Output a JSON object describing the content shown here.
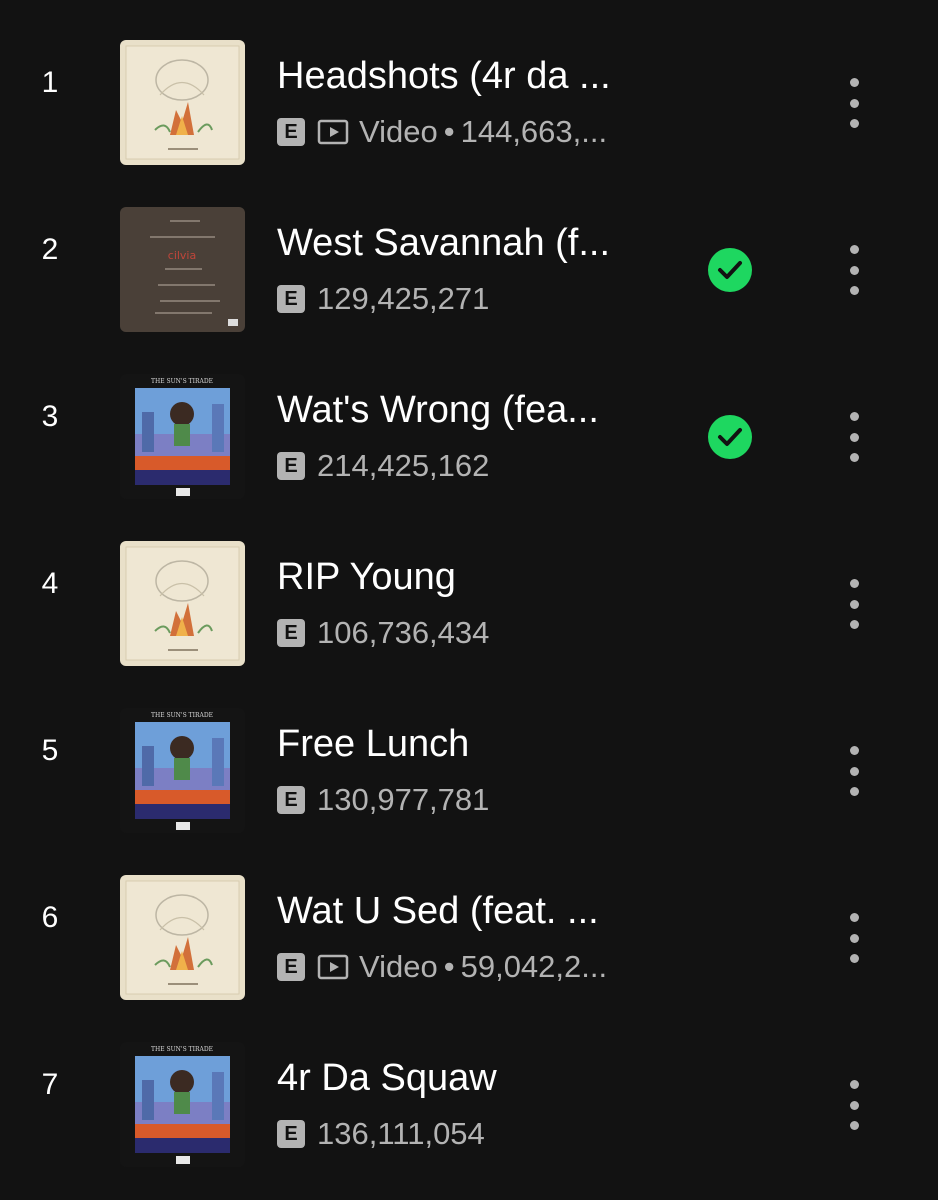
{
  "colors": {
    "background": "#121212",
    "text": "#ffffff",
    "subtext": "#b3b3b3",
    "accent_green": "#1ed760"
  },
  "tracks": [
    {
      "number": "1",
      "title": "Headshots (4r da ...",
      "explicit": "E",
      "has_video": true,
      "video_label": "Video",
      "sep": "•",
      "plays": "144,663,...",
      "downloaded": false,
      "art": "cream-sketch"
    },
    {
      "number": "2",
      "title": "West Savannah (f...",
      "explicit": "E",
      "has_video": false,
      "plays": "129,425,271",
      "downloaded": true,
      "art": "brown-tracklist"
    },
    {
      "number": "3",
      "title": "Wat's Wrong (fea...",
      "explicit": "E",
      "has_video": false,
      "plays": "214,425,162",
      "downloaded": true,
      "art": "suns-tirade"
    },
    {
      "number": "4",
      "title": "RIP Young",
      "explicit": "E",
      "has_video": false,
      "plays": "106,736,434",
      "downloaded": false,
      "art": "cream-sketch"
    },
    {
      "number": "5",
      "title": "Free Lunch",
      "explicit": "E",
      "has_video": false,
      "plays": "130,977,781",
      "downloaded": false,
      "art": "suns-tirade"
    },
    {
      "number": "6",
      "title": "Wat U Sed (feat. ...",
      "explicit": "E",
      "has_video": true,
      "video_label": "Video",
      "sep": "•",
      "plays": "59,042,2...",
      "downloaded": false,
      "art": "cream-sketch"
    },
    {
      "number": "7",
      "title": "4r Da Squaw",
      "explicit": "E",
      "has_video": false,
      "plays": "136,111,054",
      "downloaded": false,
      "art": "suns-tirade"
    }
  ],
  "icons": {
    "more": "more-vertical-icon",
    "downloaded": "check-circle-icon",
    "video": "video-play-icon"
  }
}
